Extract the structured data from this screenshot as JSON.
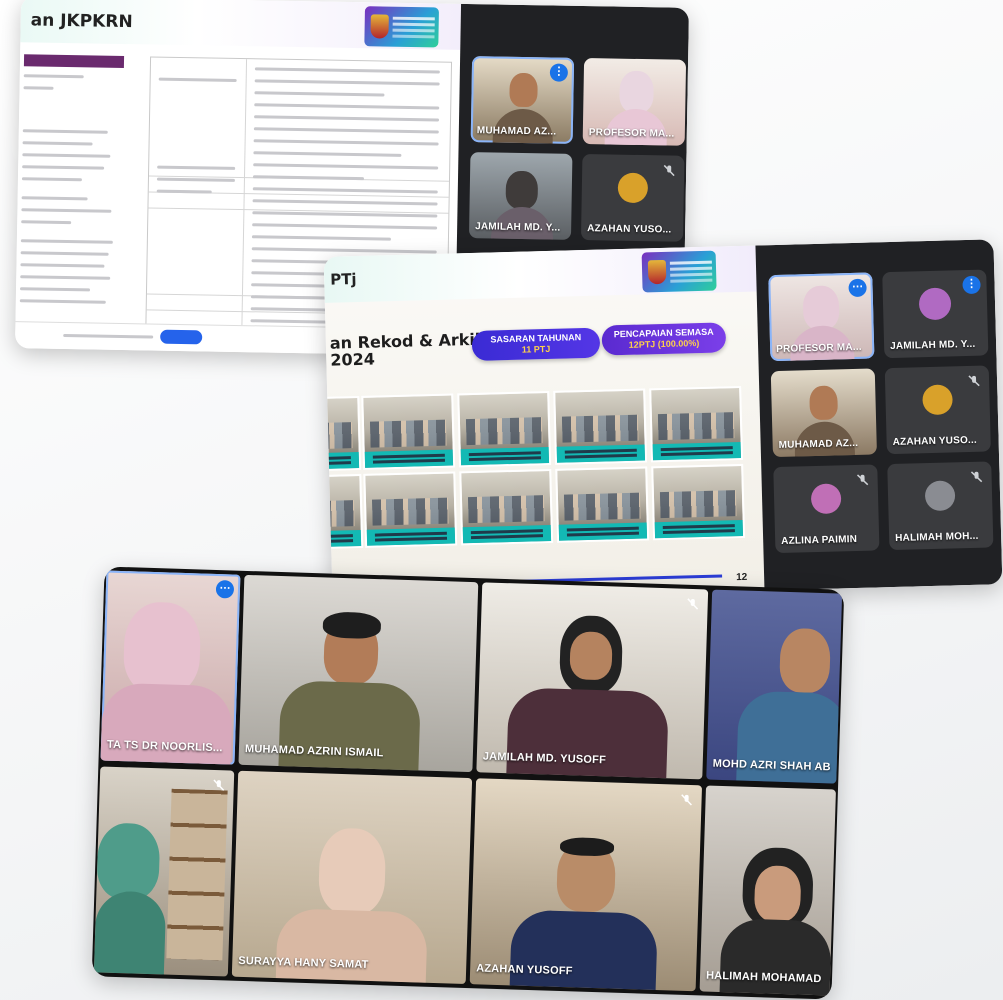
{
  "panel1": {
    "slide_title": "an JKPKRN",
    "participants": [
      {
        "name": "MUHAMAD AZ...",
        "badge": "audio"
      },
      {
        "name": "PROFESOR MA...",
        "badge": ""
      },
      {
        "name": "JAMILAH MD. Y...",
        "badge": ""
      },
      {
        "name": "AZAHAN YUSO...",
        "badge": "muted"
      }
    ]
  },
  "panel2": {
    "slide_title": "PTj",
    "heading_line1": "an Rekod & Arkib",
    "heading_line2": "2024",
    "target_label": "SASARAN TAHUNAN",
    "target_value": "11 PTJ",
    "achievement_label": "PENCAPAIAN SEMASA",
    "achievement_value": "12PTJ (100.00%)",
    "page_number": "12",
    "participants": [
      {
        "name": "PROFESOR MA...",
        "badge": "more"
      },
      {
        "name": "JAMILAH MD. Y...",
        "badge": "audio"
      },
      {
        "name": "MUHAMAD AZ...",
        "badge": ""
      },
      {
        "name": "AZAHAN YUSO...",
        "badge": "muted"
      },
      {
        "name": "AZLINA PAIMIN",
        "badge": "muted"
      },
      {
        "name": "HALIMAH MOH...",
        "badge": "muted"
      }
    ]
  },
  "panel3": {
    "participants": [
      {
        "name": "TA TS DR NOORLIS...",
        "badge": "more"
      },
      {
        "name": "MUHAMAD AZRIN ISMAIL",
        "badge": ""
      },
      {
        "name": "JAMILAH MD. YUSOFF",
        "badge": "muted"
      },
      {
        "name": "MOHD AZRI SHAH AB",
        "badge": ""
      },
      {
        "name": "",
        "badge": "muted"
      },
      {
        "name": "SURAYYA HANY SAMAT",
        "badge": ""
      },
      {
        "name": "AZAHAN YUSOFF",
        "badge": "muted"
      },
      {
        "name": "HALIMAH MOHAMAD",
        "badge": ""
      }
    ]
  },
  "icons": {
    "more": "more-options-icon",
    "audio": "speaking-indicator-icon",
    "muted": "mic-off-icon"
  },
  "colors": {
    "meet_dark": "#202124",
    "accent_blue": "#1a73e8",
    "badge_blue": "#3a2bd4",
    "caption_teal": "#13b9b4"
  }
}
